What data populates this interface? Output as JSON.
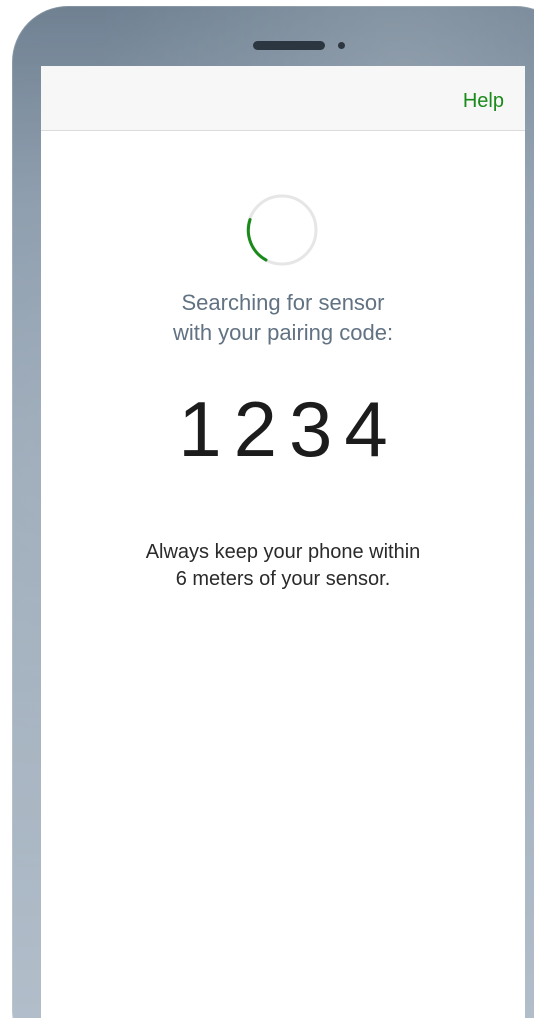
{
  "nav": {
    "help_label": "Help"
  },
  "pairing": {
    "status_line1": "Searching for sensor",
    "status_line2": "with your pairing code:",
    "code": "1234",
    "note_line1": "Always keep your phone within",
    "note_line2": "6 meters of your sensor."
  },
  "spinner": {
    "icon": "loading-spinner-icon",
    "track_color": "#e6e6e6",
    "arc_color": "#1a8a1a"
  },
  "colors": {
    "accent": "#1a8a1a",
    "status_text": "#617283",
    "body_text": "#2a2a2a"
  }
}
